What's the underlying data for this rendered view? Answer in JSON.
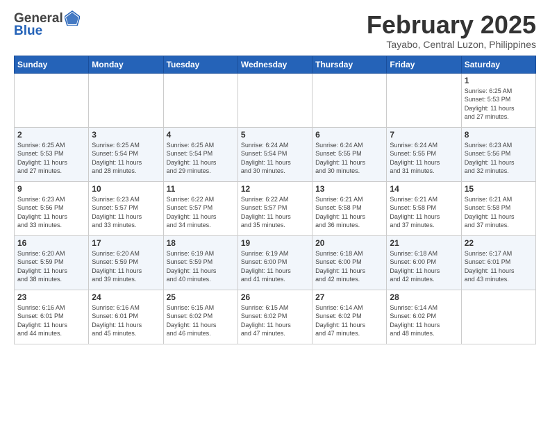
{
  "logo": {
    "general": "General",
    "blue": "Blue"
  },
  "title": "February 2025",
  "subtitle": "Tayabo, Central Luzon, Philippines",
  "days_of_week": [
    "Sunday",
    "Monday",
    "Tuesday",
    "Wednesday",
    "Thursday",
    "Friday",
    "Saturday"
  ],
  "weeks": [
    {
      "days": [
        {
          "num": "",
          "info": ""
        },
        {
          "num": "",
          "info": ""
        },
        {
          "num": "",
          "info": ""
        },
        {
          "num": "",
          "info": ""
        },
        {
          "num": "",
          "info": ""
        },
        {
          "num": "",
          "info": ""
        },
        {
          "num": "1",
          "info": "Sunrise: 6:25 AM\nSunset: 5:53 PM\nDaylight: 11 hours\nand 27 minutes."
        }
      ]
    },
    {
      "days": [
        {
          "num": "2",
          "info": "Sunrise: 6:25 AM\nSunset: 5:53 PM\nDaylight: 11 hours\nand 27 minutes."
        },
        {
          "num": "3",
          "info": "Sunrise: 6:25 AM\nSunset: 5:54 PM\nDaylight: 11 hours\nand 28 minutes."
        },
        {
          "num": "4",
          "info": "Sunrise: 6:25 AM\nSunset: 5:54 PM\nDaylight: 11 hours\nand 29 minutes."
        },
        {
          "num": "5",
          "info": "Sunrise: 6:24 AM\nSunset: 5:54 PM\nDaylight: 11 hours\nand 30 minutes."
        },
        {
          "num": "6",
          "info": "Sunrise: 6:24 AM\nSunset: 5:55 PM\nDaylight: 11 hours\nand 30 minutes."
        },
        {
          "num": "7",
          "info": "Sunrise: 6:24 AM\nSunset: 5:55 PM\nDaylight: 11 hours\nand 31 minutes."
        },
        {
          "num": "8",
          "info": "Sunrise: 6:23 AM\nSunset: 5:56 PM\nDaylight: 11 hours\nand 32 minutes."
        }
      ]
    },
    {
      "days": [
        {
          "num": "9",
          "info": "Sunrise: 6:23 AM\nSunset: 5:56 PM\nDaylight: 11 hours\nand 33 minutes."
        },
        {
          "num": "10",
          "info": "Sunrise: 6:23 AM\nSunset: 5:57 PM\nDaylight: 11 hours\nand 33 minutes."
        },
        {
          "num": "11",
          "info": "Sunrise: 6:22 AM\nSunset: 5:57 PM\nDaylight: 11 hours\nand 34 minutes."
        },
        {
          "num": "12",
          "info": "Sunrise: 6:22 AM\nSunset: 5:57 PM\nDaylight: 11 hours\nand 35 minutes."
        },
        {
          "num": "13",
          "info": "Sunrise: 6:21 AM\nSunset: 5:58 PM\nDaylight: 11 hours\nand 36 minutes."
        },
        {
          "num": "14",
          "info": "Sunrise: 6:21 AM\nSunset: 5:58 PM\nDaylight: 11 hours\nand 37 minutes."
        },
        {
          "num": "15",
          "info": "Sunrise: 6:21 AM\nSunset: 5:58 PM\nDaylight: 11 hours\nand 37 minutes."
        }
      ]
    },
    {
      "days": [
        {
          "num": "16",
          "info": "Sunrise: 6:20 AM\nSunset: 5:59 PM\nDaylight: 11 hours\nand 38 minutes."
        },
        {
          "num": "17",
          "info": "Sunrise: 6:20 AM\nSunset: 5:59 PM\nDaylight: 11 hours\nand 39 minutes."
        },
        {
          "num": "18",
          "info": "Sunrise: 6:19 AM\nSunset: 5:59 PM\nDaylight: 11 hours\nand 40 minutes."
        },
        {
          "num": "19",
          "info": "Sunrise: 6:19 AM\nSunset: 6:00 PM\nDaylight: 11 hours\nand 41 minutes."
        },
        {
          "num": "20",
          "info": "Sunrise: 6:18 AM\nSunset: 6:00 PM\nDaylight: 11 hours\nand 42 minutes."
        },
        {
          "num": "21",
          "info": "Sunrise: 6:18 AM\nSunset: 6:00 PM\nDaylight: 11 hours\nand 42 minutes."
        },
        {
          "num": "22",
          "info": "Sunrise: 6:17 AM\nSunset: 6:01 PM\nDaylight: 11 hours\nand 43 minutes."
        }
      ]
    },
    {
      "days": [
        {
          "num": "23",
          "info": "Sunrise: 6:16 AM\nSunset: 6:01 PM\nDaylight: 11 hours\nand 44 minutes."
        },
        {
          "num": "24",
          "info": "Sunrise: 6:16 AM\nSunset: 6:01 PM\nDaylight: 11 hours\nand 45 minutes."
        },
        {
          "num": "25",
          "info": "Sunrise: 6:15 AM\nSunset: 6:02 PM\nDaylight: 11 hours\nand 46 minutes."
        },
        {
          "num": "26",
          "info": "Sunrise: 6:15 AM\nSunset: 6:02 PM\nDaylight: 11 hours\nand 47 minutes."
        },
        {
          "num": "27",
          "info": "Sunrise: 6:14 AM\nSunset: 6:02 PM\nDaylight: 11 hours\nand 47 minutes."
        },
        {
          "num": "28",
          "info": "Sunrise: 6:14 AM\nSunset: 6:02 PM\nDaylight: 11 hours\nand 48 minutes."
        },
        {
          "num": "",
          "info": ""
        }
      ]
    }
  ]
}
